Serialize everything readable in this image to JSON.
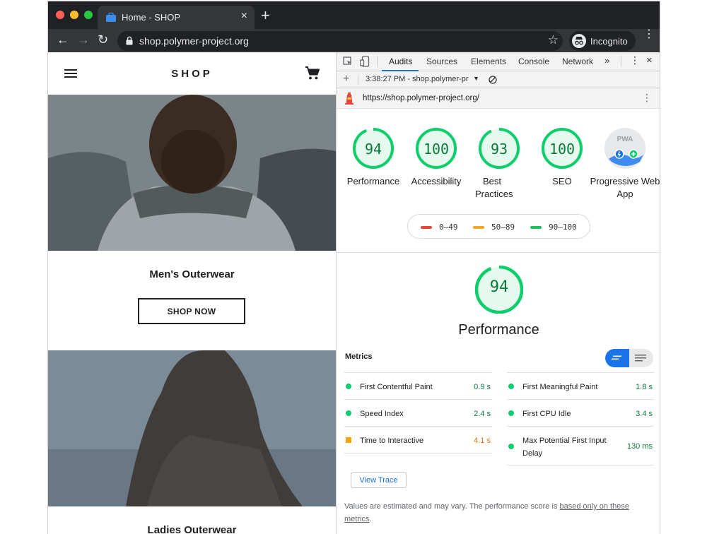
{
  "browser": {
    "tab_title": "Home - SHOP",
    "url": "shop.polymer-project.org",
    "profile_label": "Incognito"
  },
  "shop": {
    "title": "SHOP",
    "categories": [
      {
        "title": "Men's Outerwear",
        "button": "SHOP NOW"
      },
      {
        "title": "Ladies Outerwear"
      }
    ]
  },
  "devtools": {
    "tabs": [
      "Audits",
      "Sources",
      "Elements",
      "Console",
      "Network"
    ],
    "active_tab": "Audits",
    "report_time": "3:38:27 PM - shop.polymer-pr",
    "audited_url": "https://shop.polymer-project.org/",
    "scores": [
      {
        "label": "Performance",
        "value": "94"
      },
      {
        "label": "Accessibility",
        "value": "100"
      },
      {
        "label": "Best Practices",
        "value": "93"
      },
      {
        "label": "SEO",
        "value": "100"
      }
    ],
    "pwa": {
      "label": "Progressive Web App",
      "badge": "PWA"
    },
    "legend": [
      {
        "range": "0–49",
        "color": "#e8453c"
      },
      {
        "range": "50–89",
        "color": "#f4a623"
      },
      {
        "range": "90–100",
        "color": "#1ec05f"
      }
    ],
    "performance": {
      "score": "94",
      "title": "Performance",
      "metrics_title": "Metrics",
      "metrics_left": [
        {
          "name": "First Contentful Paint",
          "value": "0.9 s",
          "status": "pass"
        },
        {
          "name": "Speed Index",
          "value": "2.4 s",
          "status": "pass"
        },
        {
          "name": "Time to Interactive",
          "value": "4.1 s",
          "status": "average"
        }
      ],
      "metrics_right": [
        {
          "name": "First Meaningful Paint",
          "value": "1.8 s",
          "status": "pass"
        },
        {
          "name": "First CPU Idle",
          "value": "3.4 s",
          "status": "pass"
        },
        {
          "name": "Max Potential First Input Delay",
          "value": "130 ms",
          "status": "pass"
        }
      ],
      "view_trace": "View Trace",
      "note": "Values are estimated and may vary. The performance score is ",
      "note_link": "based only on these metrics",
      "note_end": "."
    },
    "colors": {
      "pass": "#0cce6b",
      "average": "#ffa400",
      "fail": "#ff4e42",
      "accent": "#1a73e8"
    }
  }
}
